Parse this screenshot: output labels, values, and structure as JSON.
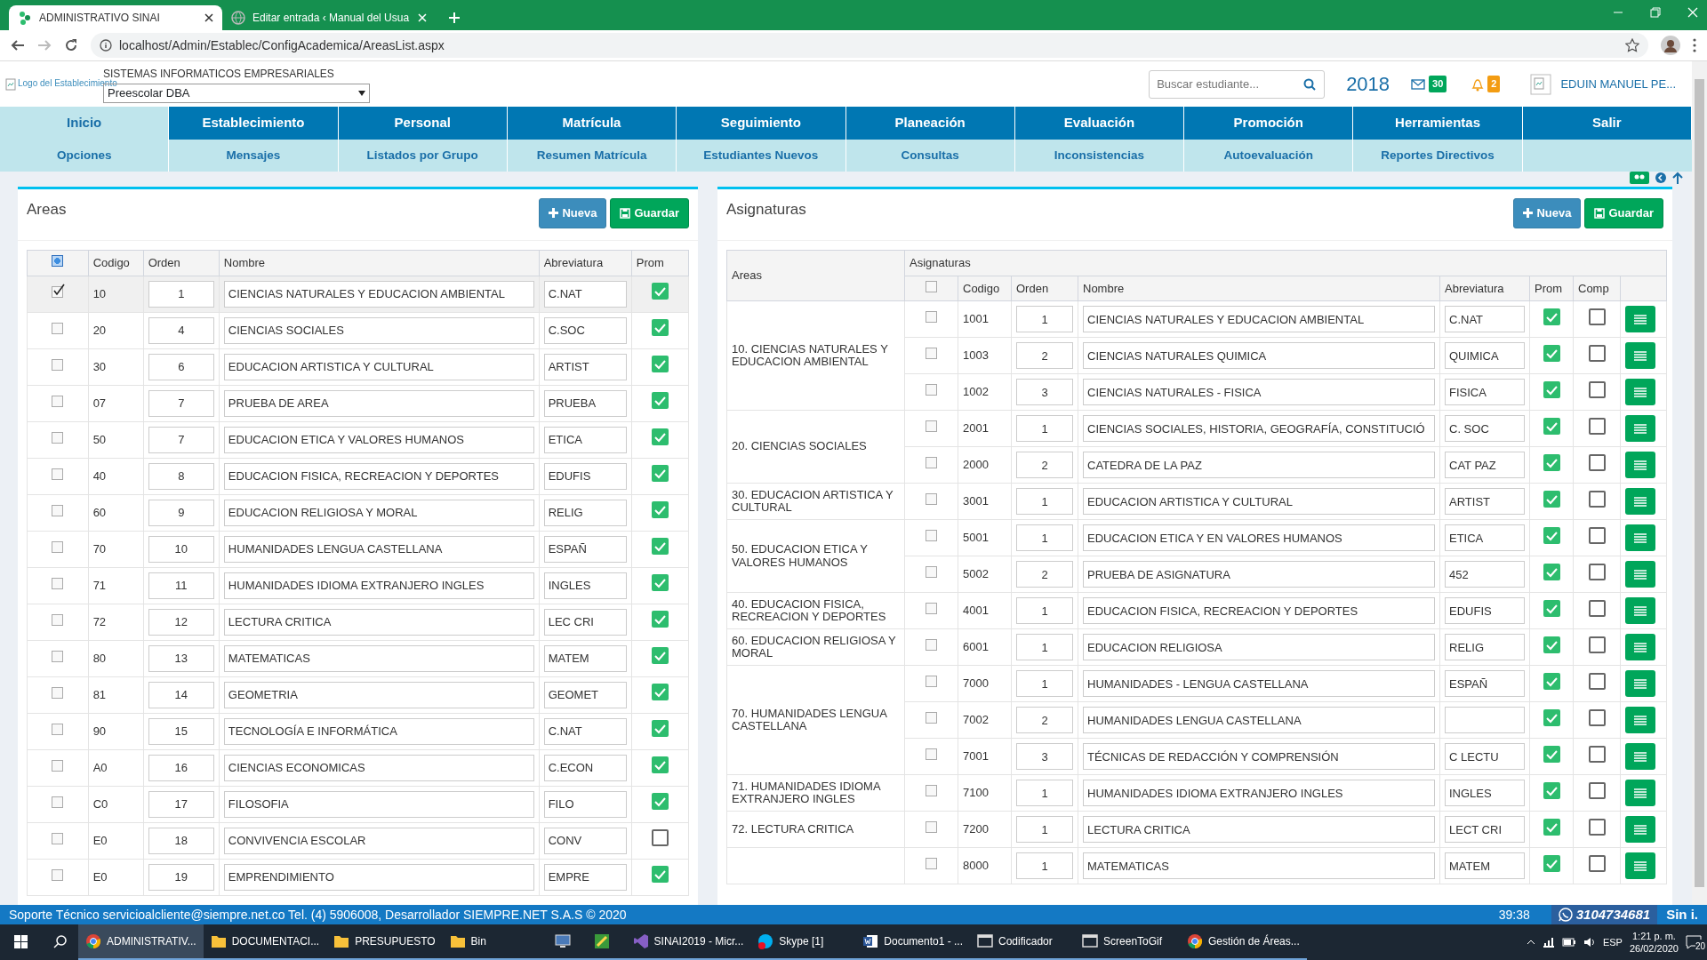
{
  "browser": {
    "tabs": [
      {
        "title": "ADMINISTRATIVO SINAI",
        "selected": true,
        "kind": "app"
      },
      {
        "title": "Editar entrada ‹ Manual del Usua",
        "selected": false,
        "kind": "web"
      }
    ],
    "url": "localhost/Admin/Establec/ConfigAcademica/AreasList.aspx"
  },
  "header": {
    "logo_alt": "Logo del Establecimiento",
    "company": "SISTEMAS INFORMATICOS EMPRESARIALES",
    "period_select": "Preescolar DBA",
    "search": {
      "placeholder": "Buscar estudiante..."
    },
    "year": "2018",
    "messages": "30",
    "notifications": "2",
    "user": "EDUIN MANUEL PE..."
  },
  "menu": [
    {
      "label": "Inicio",
      "selected": true
    },
    {
      "label": "Establecimiento",
      "selected": false
    },
    {
      "label": "Personal",
      "selected": false
    },
    {
      "label": "Matrícula",
      "selected": false
    },
    {
      "label": "Seguimiento",
      "selected": false
    },
    {
      "label": "Planeación",
      "selected": false
    },
    {
      "label": "Evaluación",
      "selected": false
    },
    {
      "label": "Promoción",
      "selected": false
    },
    {
      "label": "Herramientas",
      "selected": false
    },
    {
      "label": "Salir",
      "selected": false
    }
  ],
  "submenu": [
    "Opciones",
    "Mensajes",
    "Listados por Grupo",
    "Resumen Matrícula",
    "Estudiantes Nuevos",
    "Consultas",
    "Inconsistencias",
    "Autoevaluación",
    "Reportes Directivos"
  ],
  "areas": {
    "title": "Areas",
    "buttons": [
      {
        "label": "Nueva",
        "kind": "new"
      },
      {
        "label": "Guardar",
        "kind": "save"
      }
    ],
    "select_all": {
      "indeterminate": true
    },
    "columns": [
      "Codigo",
      "Orden",
      "Nombre",
      "Abreviatura",
      "Prom"
    ],
    "rows": [
      {
        "selected": true,
        "codigo": "10",
        "orden": "1",
        "nombre": "CIENCIAS NATURALES Y EDUCACION AMBIENTAL",
        "abreviatura": "C.NAT",
        "prom": true
      },
      {
        "selected": false,
        "codigo": "20",
        "orden": "4",
        "nombre": "CIENCIAS SOCIALES",
        "abreviatura": "C.SOC",
        "prom": true
      },
      {
        "selected": false,
        "codigo": "30",
        "orden": "6",
        "nombre": "EDUCACION ARTISTICA Y CULTURAL",
        "abreviatura": "ARTIST",
        "prom": true
      },
      {
        "selected": false,
        "codigo": "07",
        "orden": "7",
        "nombre": "PRUEBA DE AREA",
        "abreviatura": "PRUEBA",
        "prom": true
      },
      {
        "selected": false,
        "codigo": "50",
        "orden": "7",
        "nombre": "EDUCACION ETICA Y VALORES HUMANOS",
        "abreviatura": "ETICA",
        "prom": true
      },
      {
        "selected": false,
        "codigo": "40",
        "orden": "8",
        "nombre": "EDUCACION FISICA, RECREACION Y DEPORTES",
        "abreviatura": "EDUFIS",
        "prom": true
      },
      {
        "selected": false,
        "codigo": "60",
        "orden": "9",
        "nombre": "EDUCACION RELIGIOSA Y MORAL",
        "abreviatura": "RELIG",
        "prom": true
      },
      {
        "selected": false,
        "codigo": "70",
        "orden": "10",
        "nombre": "HUMANIDADES LENGUA CASTELLANA",
        "abreviatura": "ESPAÑ",
        "prom": true
      },
      {
        "selected": false,
        "codigo": "71",
        "orden": "11",
        "nombre": "HUMANIDADES IDIOMA EXTRANJERO INGLES",
        "abreviatura": "INGLES",
        "prom": true
      },
      {
        "selected": false,
        "codigo": "72",
        "orden": "12",
        "nombre": "LECTURA CRITICA",
        "abreviatura": "LEC CRI",
        "prom": true
      },
      {
        "selected": false,
        "codigo": "80",
        "orden": "13",
        "nombre": "MATEMATICAS",
        "abreviatura": "MATEM",
        "prom": true
      },
      {
        "selected": false,
        "codigo": "81",
        "orden": "14",
        "nombre": "GEOMETRIA",
        "abreviatura": "GEOMET",
        "prom": true
      },
      {
        "selected": false,
        "codigo": "90",
        "orden": "15",
        "nombre": "TECNOLOGÍA E INFORMÁTICA",
        "abreviatura": "C.NAT",
        "prom": true
      },
      {
        "selected": false,
        "codigo": "A0",
        "orden": "16",
        "nombre": "CIENCIAS ECONOMICAS",
        "abreviatura": "C.ECON",
        "prom": true
      },
      {
        "selected": false,
        "codigo": "C0",
        "orden": "17",
        "nombre": "FILOSOFIA",
        "abreviatura": "FILO",
        "prom": true
      },
      {
        "selected": false,
        "codigo": "E0",
        "orden": "18",
        "nombre": "CONVIVENCIA ESCOLAR",
        "abreviatura": "CONV",
        "prom": false
      },
      {
        "selected": false,
        "codigo": "E0",
        "orden": "19",
        "nombre": "EMPRENDIMIENTO",
        "abreviatura": "EMPRE",
        "prom": true
      }
    ]
  },
  "asignaturas": {
    "title": "Asignaturas",
    "buttons": [
      {
        "label": "Nueva",
        "kind": "new"
      },
      {
        "label": "Guardar",
        "kind": "save"
      }
    ],
    "areas_header": "Areas",
    "group_header": "Asignaturas",
    "select_all": {
      "checked": false,
      "indeterminate": false
    },
    "columns": [
      "Codigo",
      "Orden",
      "Nombre",
      "Abreviatura",
      "Prom",
      "Comp"
    ],
    "groups": [
      {
        "area": "10. CIENCIAS NATURALES Y EDUCACION AMBIENTAL",
        "subjects": [
          {
            "checked": false,
            "codigo": "1001",
            "orden": "1",
            "nombre": "CIENCIAS NATURALES Y EDUCACION AMBIENTAL",
            "abreviatura": "C.NAT",
            "prom": true,
            "comp": false
          },
          {
            "checked": false,
            "codigo": "1003",
            "orden": "2",
            "nombre": "CIENCIAS NATURALES QUIMICA",
            "abreviatura": "QUIMICA",
            "prom": true,
            "comp": false
          },
          {
            "checked": false,
            "codigo": "1002",
            "orden": "3",
            "nombre": "CIENCIAS NATURALES - FISICA",
            "abreviatura": "FISICA",
            "prom": true,
            "comp": false
          }
        ]
      },
      {
        "area": "20. CIENCIAS SOCIALES",
        "subjects": [
          {
            "checked": false,
            "codigo": "2001",
            "orden": "1",
            "nombre": "CIENCIAS SOCIALES, HISTORIA, GEOGRAFÍA, CONSTITUCIÓ",
            "abreviatura": "C. SOC",
            "prom": true,
            "comp": false
          },
          {
            "checked": false,
            "codigo": "2000",
            "orden": "2",
            "nombre": "CATEDRA DE LA PAZ",
            "abreviatura": "CAT PAZ",
            "prom": true,
            "comp": false
          }
        ]
      },
      {
        "area": "30. EDUCACION ARTISTICA Y CULTURAL",
        "subjects": [
          {
            "checked": false,
            "codigo": "3001",
            "orden": "1",
            "nombre": "EDUCACION ARTISTICA Y CULTURAL",
            "abreviatura": "ARTIST",
            "prom": true,
            "comp": false
          }
        ]
      },
      {
        "area": "50. EDUCACION ETICA Y VALORES HUMANOS",
        "subjects": [
          {
            "checked": false,
            "codigo": "5001",
            "orden": "1",
            "nombre": "EDUCACION ETICA Y EN VALORES HUMANOS",
            "abreviatura": "ETICA",
            "prom": true,
            "comp": false
          },
          {
            "checked": false,
            "codigo": "5002",
            "orden": "2",
            "nombre": "PRUEBA DE ASIGNATURA",
            "abreviatura": "452",
            "prom": true,
            "comp": false
          }
        ]
      },
      {
        "area": "40. EDUCACION FISICA, RECREACION Y DEPORTES",
        "subjects": [
          {
            "checked": false,
            "codigo": "4001",
            "orden": "1",
            "nombre": "EDUCACION FISICA, RECREACION Y DEPORTES",
            "abreviatura": "EDUFIS",
            "prom": true,
            "comp": false
          }
        ]
      },
      {
        "area": "60. EDUCACION RELIGIOSA Y MORAL",
        "subjects": [
          {
            "checked": false,
            "codigo": "6001",
            "orden": "1",
            "nombre": "EDUCACION RELIGIOSA",
            "abreviatura": "RELIG",
            "prom": true,
            "comp": false
          }
        ]
      },
      {
        "area": "70. HUMANIDADES LENGUA CASTELLANA",
        "subjects": [
          {
            "checked": false,
            "codigo": "7000",
            "orden": "1",
            "nombre": "HUMANIDADES - LENGUA CASTELLANA",
            "abreviatura": "ESPAÑ",
            "prom": true,
            "comp": false
          },
          {
            "checked": false,
            "codigo": "7002",
            "orden": "2",
            "nombre": "HUMANIDADES LENGUA CASTELLANA",
            "prom": true,
            "comp": false
          },
          {
            "checked": false,
            "codigo": "7001",
            "orden": "3",
            "nombre": "TÉCNICAS DE REDACCIÓN Y COMPRENSIÓN",
            "abreviatura": "C LECTU",
            "prom": true,
            "comp": false
          }
        ]
      },
      {
        "area": "71. HUMANIDADES IDIOMA EXTRANJERO INGLES",
        "subjects": [
          {
            "checked": false,
            "codigo": "7100",
            "orden": "1",
            "nombre": "HUMANIDADES IDIOMA EXTRANJERO INGLES",
            "abreviatura": "INGLES",
            "prom": true,
            "comp": false
          }
        ]
      },
      {
        "area": "72. LECTURA CRITICA",
        "subjects": [
          {
            "checked": false,
            "codigo": "7200",
            "orden": "1",
            "nombre": "LECTURA CRITICA",
            "abreviatura": "LECT CRI",
            "prom": true,
            "comp": false
          }
        ]
      },
      {
        "subjects": [
          {
            "checked": false,
            "codigo": "8000",
            "orden": "1",
            "nombre": "MATEMATICAS",
            "abreviatura": "MATEM",
            "prom": true,
            "comp": false
          }
        ]
      }
    ]
  },
  "status_bar": {
    "support_label": "Soporte Técnico",
    "support_email": "servicioalcliente@siempre.net.co",
    "contact_text": "Tel. (4) 5906008, Desarrollador",
    "developer": "SIEMPRE.NET S.A.S",
    "copyright": "© 2020",
    "timer": "39:38",
    "phone": "3104734681",
    "brand": "Sin i."
  },
  "taskbar": {
    "items": [
      {
        "label": "ADMINISTRATIV...",
        "kind": "chrome",
        "selected": true
      },
      {
        "label": "DOCUMENTACI...",
        "kind": "folder",
        "selected": false
      },
      {
        "label": "PRESUPUESTO",
        "kind": "folder",
        "selected": false
      },
      {
        "label": "Bin",
        "kind": "folder",
        "selected": false
      },
      {
        "kind": "monitor",
        "selected": false
      },
      {
        "kind": "tool",
        "selected": false
      },
      {
        "label": "SINAI2019 - Micr...",
        "kind": "studio",
        "selected": false
      },
      {
        "label": "Skype [1]",
        "kind": "skype",
        "selected": false
      },
      {
        "label": "Documento1 - ...",
        "kind": "word",
        "selected": false
      },
      {
        "label": "Codificador",
        "kind": "window",
        "selected": false
      },
      {
        "label": "ScreenToGif",
        "kind": "window",
        "selected": false
      },
      {
        "label": "Gestión de Áreas...",
        "kind": "chrome",
        "selected": false
      }
    ],
    "language": "ESP",
    "time": "1:21 p. m.",
    "date": "26/02/2020",
    "notifications": "20"
  }
}
